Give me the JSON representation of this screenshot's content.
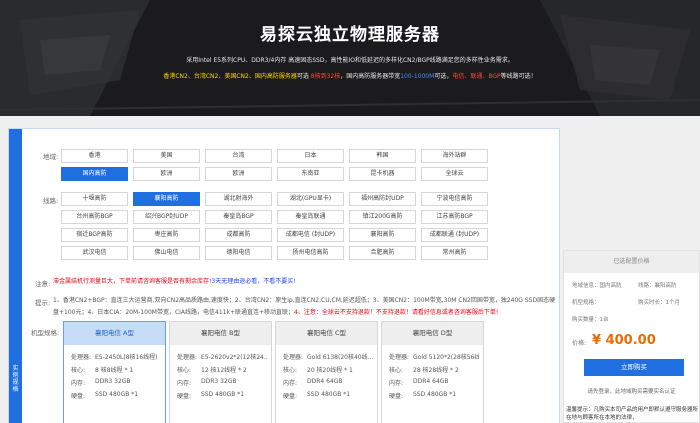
{
  "banner": {
    "title": "易探云独立物理服务器",
    "line1": "采用Intel E5系列CPU、DDR3/4内存 高速固态SSD，高性能IO和低延迟的多样化CN2/BGP线路满足您的多样性业务需求。",
    "line2_parts": [
      {
        "text": "香港CN2、",
        "color": "yellow"
      },
      {
        "text": "台湾CN2、",
        "color": "yellow"
      },
      {
        "text": "美国CN2、",
        "color": "yellow"
      },
      {
        "text": "国内高防服务器",
        "color": "yellow"
      },
      {
        "text": "可选 ",
        "color": "white"
      },
      {
        "text": "8核到32核",
        "color": "red"
      },
      {
        "text": "，国内高防服务器带宽",
        "color": "white"
      },
      {
        "text": "100-1000M",
        "color": "blue"
      },
      {
        "text": "可选，",
        "color": "white"
      },
      {
        "text": "电信、",
        "color": "red"
      },
      {
        "text": "联通、",
        "color": "red"
      },
      {
        "text": "BGP",
        "color": "red"
      },
      {
        "text": "等线路可选！",
        "color": "white"
      }
    ]
  },
  "side_tab": "实例规格",
  "region": {
    "label": "地域:",
    "options": [
      "香港",
      "美国",
      "台湾",
      "日本",
      "韩国",
      "海外站群",
      "国内高防",
      "欧洲",
      "欧洲",
      "东南亚",
      "昆卡机器",
      "全球云"
    ],
    "active_index": 6
  },
  "line": {
    "label": "线路:",
    "options": [
      "十堰高防",
      "襄阳高防",
      "湖北射海外",
      "湖北(GPU显卡)",
      "福州高防封UDP",
      "宁波电信高防",
      "台州高防BGP",
      "绍兴BGP封UDP",
      "秦皇岛BGP",
      "秦皇岛联通",
      "镇江200G高防",
      "江苏高防BGP",
      "宿迁BGP高防",
      "枣庄高防",
      "成都高防",
      "成都电信 (封UDP)",
      "襄阳高防",
      "成都联通 (封UDP)",
      "武汉电信",
      "佛山电信",
      "德阳电信",
      "扬州电信高防",
      "合肥高防",
      "常州高防"
    ],
    "active_index": 1
  },
  "notice": {
    "label": "注意:",
    "red": "滞金属结机行测量巨大，下单前请咨询客服是否有剩余库存!",
    "blue": "3天无理由退必看，不看不要买!"
  },
  "tips": {
    "label": "提示:",
    "line1": "1、香港CN2+BGP：直连三大运营商,双向CN2高品质路由,速度快；2、台湾CN2：原生ip,直连CN2,CU,CM,延迟超低；3、美国CN2：100M带宽,30M CN2回国带宽，独240G SSD固态硬",
    "line2_grey": "盘+100元；4、日本CIA：20M-100M带宽，CIA线路，电信411k+联通直连+移动直联；",
    "line2_red": "4、注意：全球云不支持退款！不支持退款！请看好信息或者咨询客服后下单!"
  },
  "model_label": "机型规格:",
  "models": [
    {
      "name": "襄阳电信 A型",
      "cpu": "E5-2450L(8核16线程)",
      "cores": "8 核8线程 * 1",
      "ram": "DDR3 32GB",
      "disk": "SSD 480GB *1"
    },
    {
      "name": "襄阳电信 B型",
      "cpu": "E5-2620v2*2(12核24...",
      "cores": "12 核12线程 * 2",
      "ram": "DDR3 32GB",
      "disk": "SSD 480GB *1"
    },
    {
      "name": "襄阳电信 C型",
      "cpu": "Gold 6138(20核40线...",
      "cores": "20 核20线程 * 1",
      "ram": "DDR4 64GB",
      "disk": "SSD 480GB *1"
    },
    {
      "name": "襄阳电信 D型",
      "cpu": "Gold 5120*2(28核56线...",
      "cores": "28 核28线程 * 2",
      "ram": "DDR4 64GB",
      "disk": "SSD 480GB *1"
    }
  ],
  "active_model": 0,
  "spec_keys": {
    "cpu": "处理器:",
    "cores": "核心:",
    "ram": "内存:",
    "disk": "硬盘:"
  },
  "panel": {
    "title": "已选配置价格",
    "rows": [
      {
        "left": "地域信息：国内高防",
        "right": "线路：襄阳高防"
      },
      {
        "left": "机型规格：",
        "right": "购买时长：1个月"
      },
      {
        "left": "购买数量：1台",
        "right": ""
      }
    ],
    "price_label": "价格:",
    "price": "¥ 400.00",
    "buy": "立即购买",
    "tip": "请先登录，此地域购买需要实名认证"
  },
  "warning": "温馨提示：凡购买本司产品的用户即默认遵守服务器所在地与顾客所在本地的法律，"
}
